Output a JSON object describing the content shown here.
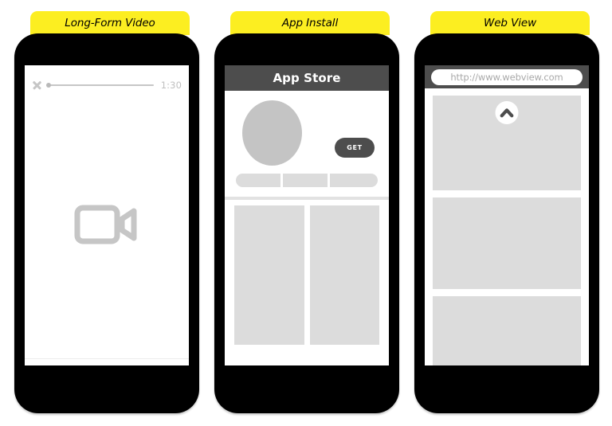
{
  "panels": [
    {
      "caption": "Long-Form Video",
      "type": "long-form-video",
      "video": {
        "close_icon": "close-x-icon",
        "progress_percent": 2,
        "duration_label": "1:30",
        "placeholder_icon": "video-camera-icon"
      }
    },
    {
      "caption": "App Install",
      "type": "app-install",
      "store": {
        "title": "App Store",
        "install_button_label": "GET",
        "avatar_icon": "app-avatar-placeholder",
        "screenshot_segments": [
          "",
          "",
          ""
        ],
        "content_columns": [
          "",
          ""
        ]
      }
    },
    {
      "caption": "Web View",
      "type": "web-view",
      "browser": {
        "url": "http://www.webview.com",
        "scroll_icon": "chevron-up-icon",
        "content_blocks": [
          "",
          "",
          ""
        ]
      }
    }
  ],
  "colors": {
    "caption_background": "#fcee21",
    "phone_body": "#000000",
    "screen": "#ffffff",
    "chrome_dark": "#4d4d4d",
    "placeholder_gray": "#dcdcdc",
    "avatar_gray": "#c4c4c4",
    "muted_text": "#c0c0c0"
  }
}
